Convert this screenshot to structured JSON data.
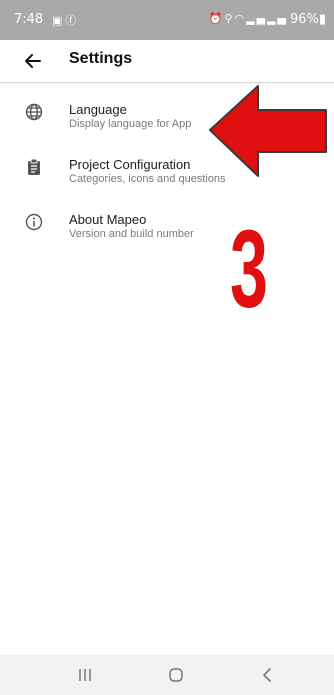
{
  "status_bar": {
    "time": "7:48",
    "left_icons": [
      "image-notification-icon",
      "facebook-icon"
    ],
    "right_icons": [
      "alarm-icon",
      "location-icon",
      "wifi-icon",
      "signal-icon",
      "signal-icon"
    ],
    "battery": "96%"
  },
  "app_bar": {
    "title": "Settings",
    "back_icon": "arrow-left-icon"
  },
  "settings": [
    {
      "icon": "globe-icon",
      "title": "Language",
      "subtitle": "Display language for App"
    },
    {
      "icon": "clipboard-icon",
      "title": "Project Configuration",
      "subtitle": "Categories, icons and questions"
    },
    {
      "icon": "info-icon",
      "title": "About Mapeo",
      "subtitle": "Version and build number"
    }
  ],
  "annotation": {
    "number": "3",
    "color": "#e01010"
  },
  "nav_bar": [
    "recent-apps-icon",
    "home-icon",
    "back-icon"
  ],
  "colors": {
    "status_bar_bg": "#a9a9a9",
    "accent_red": "#e01010"
  }
}
